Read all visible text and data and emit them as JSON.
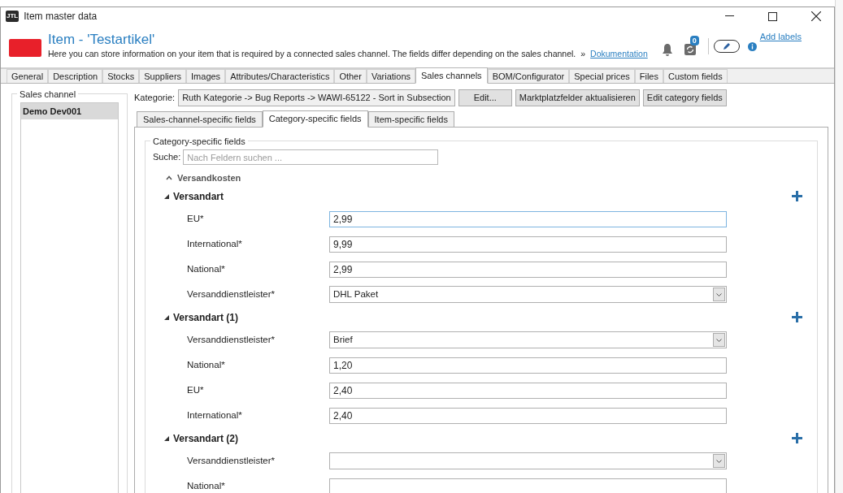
{
  "window": {
    "logo": "JTL",
    "title": "Item master data"
  },
  "header": {
    "title": "Item - 'Testartikel'",
    "description": "Here you can store information on your item that is required by a connected sales channel. The fields differ depending on the sales channel.",
    "more_marker": "»",
    "link": "Dokumentation",
    "notification_count": "0",
    "labels_link": "Add labels"
  },
  "tabs": [
    {
      "label": "General",
      "selected": false
    },
    {
      "label": "Description",
      "selected": false
    },
    {
      "label": "Stocks",
      "selected": false
    },
    {
      "label": "Suppliers",
      "selected": false
    },
    {
      "label": "Images",
      "selected": false
    },
    {
      "label": "Attributes/Characteristics",
      "selected": false
    },
    {
      "label": "Other",
      "selected": false
    },
    {
      "label": "Variations",
      "selected": false
    },
    {
      "label": "Sales channels",
      "selected": true
    },
    {
      "label": "BOM/Configurator",
      "selected": false
    },
    {
      "label": "Special prices",
      "selected": false
    },
    {
      "label": "Files",
      "selected": false
    },
    {
      "label": "Custom fields",
      "selected": false
    }
  ],
  "sales_channel": {
    "title": "Sales channel",
    "items": [
      {
        "label": "Demo Dev001",
        "selected": true
      }
    ]
  },
  "category": {
    "label": "Kategorie:",
    "value": "Ruth Kategorie -> Bug Reports -> WAWI-65122 - Sort in Subsection",
    "buttons": [
      "Edit...",
      "Marktplatzfelder aktualisieren",
      "Edit category fields"
    ]
  },
  "subtabs": [
    {
      "label": "Sales-channel-specific fields",
      "selected": false
    },
    {
      "label": "Category-specific fields",
      "selected": true
    },
    {
      "label": "Item-specific fields",
      "selected": false
    }
  ],
  "fields_panel": {
    "title": "Category-specific fields",
    "search_label": "Suche:",
    "search_placeholder": "Nach Feldern suchen ...",
    "section": {
      "title": "Versandkosten",
      "expanded": true,
      "groups": [
        {
          "title": "Versandart",
          "expanded": true,
          "fields": [
            {
              "label": "EU*",
              "kind": "text",
              "value": "2,99",
              "focused": true
            },
            {
              "label": "International*",
              "kind": "text",
              "value": "9,99",
              "focused": false
            },
            {
              "label": "National*",
              "kind": "text",
              "value": "2,99",
              "focused": false
            },
            {
              "label": "Versanddienstleister*",
              "kind": "select",
              "value": "DHL Paket",
              "focused": false
            }
          ]
        },
        {
          "title": "Versandart (1)",
          "expanded": true,
          "fields": [
            {
              "label": "Versanddienstleister*",
              "kind": "select",
              "value": "Brief",
              "focused": false
            },
            {
              "label": "National*",
              "kind": "text",
              "value": "1,20",
              "focused": false
            },
            {
              "label": "EU*",
              "kind": "text",
              "value": "2,40",
              "focused": false
            },
            {
              "label": "International*",
              "kind": "text",
              "value": "2,40",
              "focused": false
            }
          ]
        },
        {
          "title": "Versandart (2)",
          "expanded": true,
          "fields": [
            {
              "label": "Versanddienstleister*",
              "kind": "select",
              "focused": false
            },
            {
              "label": "National*",
              "kind": "text",
              "focused": false
            }
          ]
        }
      ]
    }
  }
}
